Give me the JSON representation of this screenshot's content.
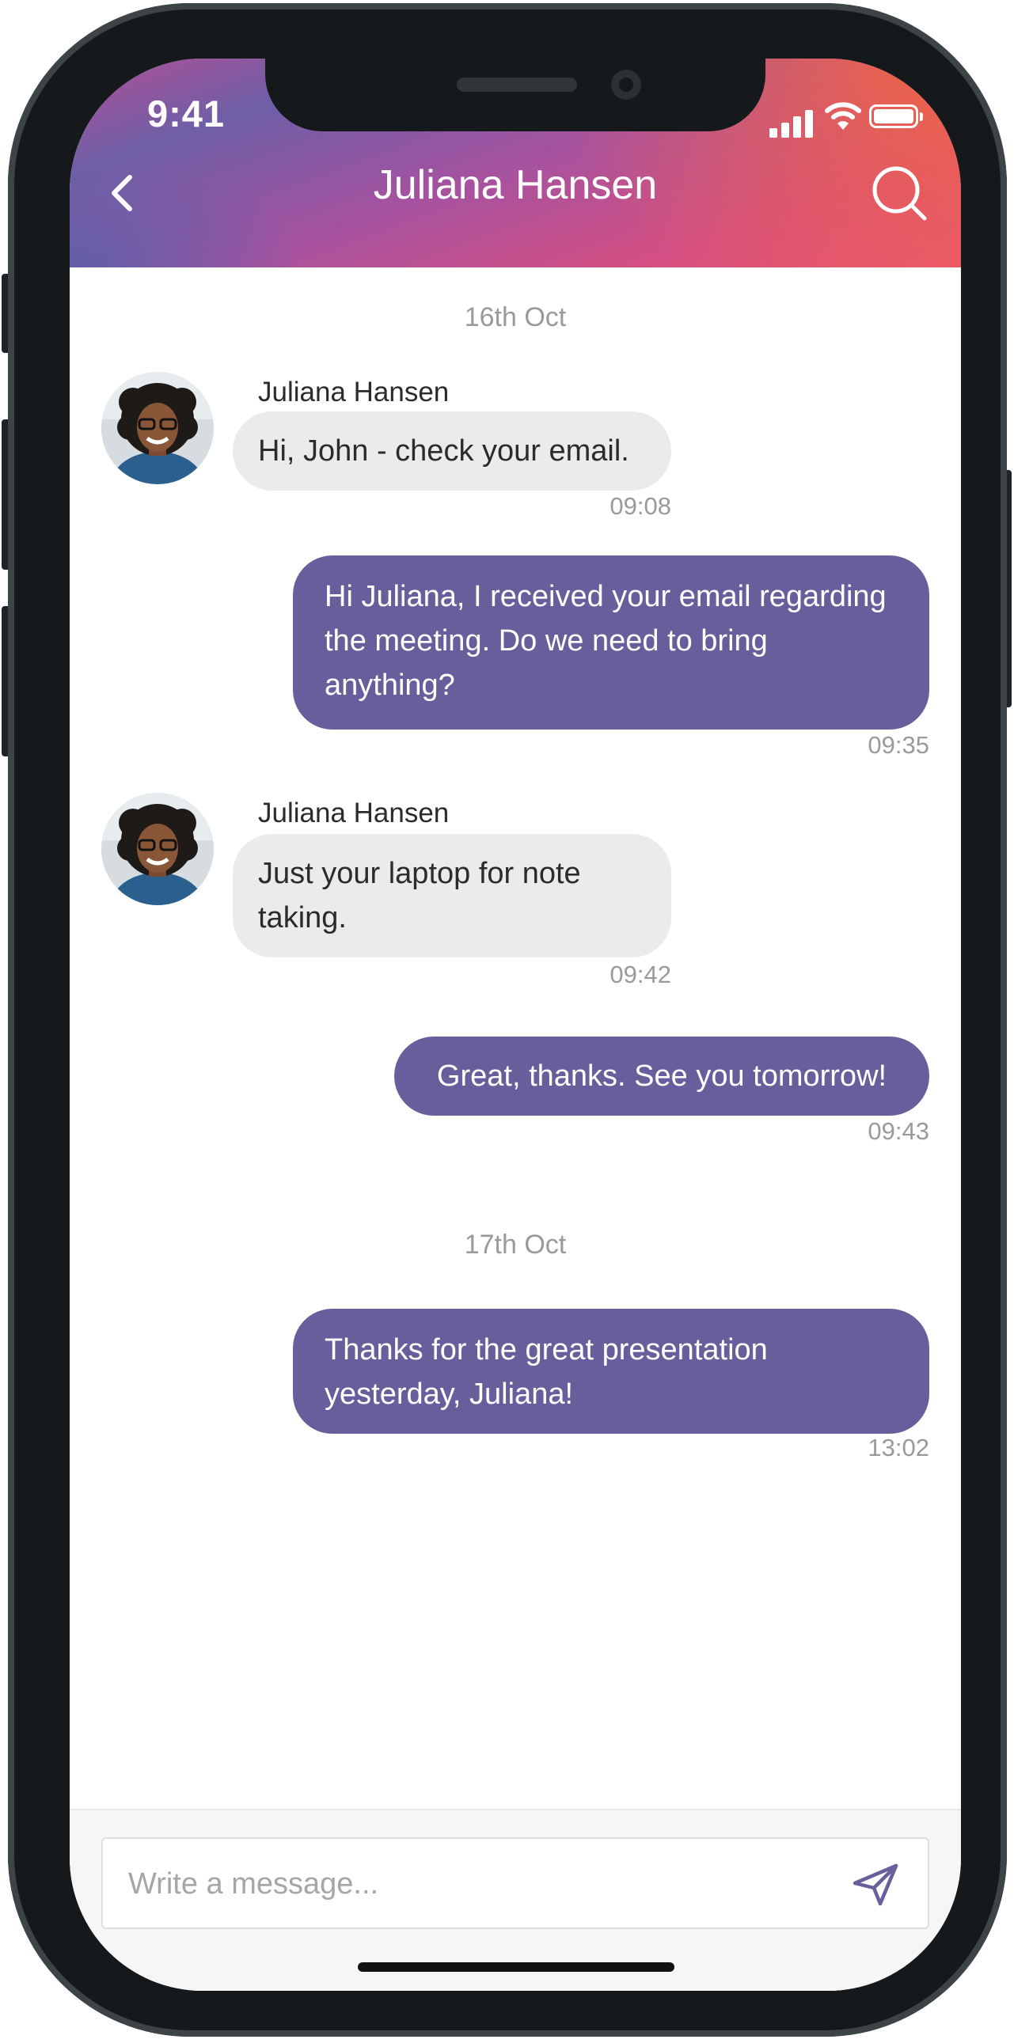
{
  "status_bar": {
    "time": "9:41"
  },
  "header": {
    "title": "Juliana Hansen"
  },
  "conversation": {
    "days": [
      {
        "date": "16th Oct",
        "messages": [
          {
            "direction": "incoming",
            "sender": "Juliana Hansen",
            "text": "Hi, John - check your email.",
            "time": "09:08"
          },
          {
            "direction": "outgoing",
            "lines": [
              "Hi Juliana, I received your email regarding",
              "the meeting. Do we need to bring",
              "anything?"
            ],
            "time": "09:35"
          },
          {
            "direction": "incoming",
            "sender": "Juliana Hansen",
            "lines": [
              "Just your laptop for note",
              "taking."
            ],
            "time": "09:42"
          },
          {
            "direction": "outgoing",
            "text": "Great, thanks. See you tomorrow!",
            "time": "09:43"
          }
        ]
      },
      {
        "date": "17th Oct",
        "messages": [
          {
            "direction": "outgoing",
            "lines": [
              "Thanks for the great presentation",
              "yesterday, Juliana!"
            ],
            "time": "13:02"
          }
        ]
      }
    ]
  },
  "composer": {
    "placeholder": "Write a message..."
  },
  "colors": {
    "outgoing_bubble": "#685e9c",
    "incoming_bubble": "#ebebeb",
    "header_gradient": [
      "#6e5fa6",
      "#b14f98",
      "#ea5670",
      "#f26542"
    ]
  },
  "icons": {
    "back": "chevron-left-icon",
    "search": "search-icon",
    "send": "paper-plane-icon"
  }
}
